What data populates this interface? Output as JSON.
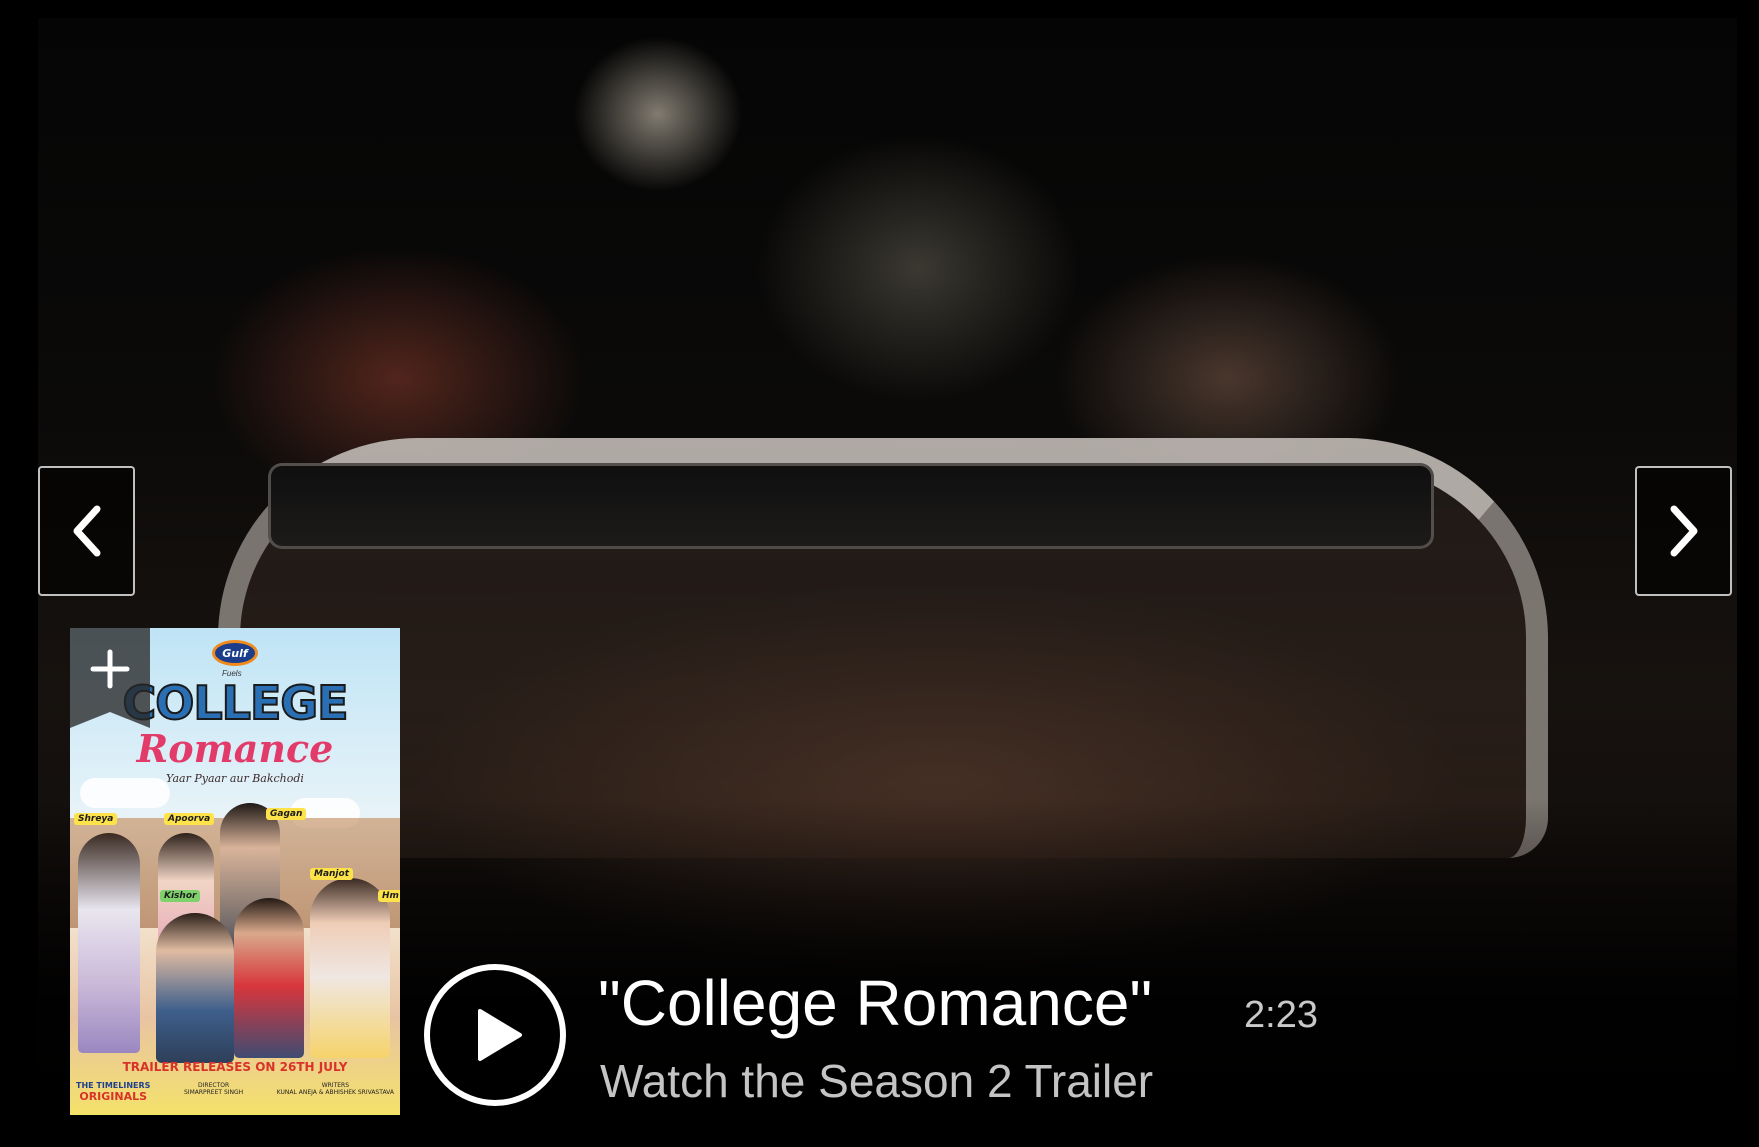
{
  "hero": {
    "image_name": "college-romance-hero-still"
  },
  "poster": {
    "sponsor_logo": "Gulf",
    "sponsor_sub": "Fuels",
    "title_line1": "COLLEGE",
    "title_line2": "Romance",
    "tagline": "Yaar Pyaar aur Bakchodi",
    "names": [
      "Shreya",
      "Apoorva",
      "Gagan",
      "Manjot",
      "Kishor",
      "Hm"
    ],
    "release_text": "TRAILER RELEASES ON 26TH JULY",
    "credits": {
      "brand_line1": "THE TIMELINERS",
      "brand_line2": "ORIGINALS",
      "director_label": "DIRECTOR",
      "director_name": "SIMARPREET SINGH",
      "writers_label": "WRITERS",
      "writers_names": "KUNAL ANEJA & ABHISHEK SRIVASTAVA"
    }
  },
  "add_button": {
    "icon": "plus-icon"
  },
  "navigation": {
    "prev_icon": "chevron-left-icon",
    "next_icon": "chevron-right-icon"
  },
  "video": {
    "title": "\"College Romance\"",
    "duration": "2:23",
    "subtitle": "Watch the Season 2 Trailer",
    "play_icon": "play-icon"
  },
  "colors": {
    "background": "#000000",
    "title_text": "#ffffff",
    "muted_text": "#c4c4c4"
  }
}
